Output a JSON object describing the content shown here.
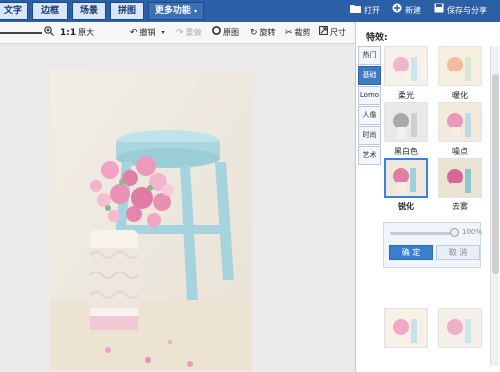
{
  "topbar": {
    "tabs": [
      "文字",
      "边框",
      "场景",
      "拼图"
    ],
    "more_label": "更多功能",
    "open_label": "打开",
    "new_label": "新建",
    "save_label": "保存与分享"
  },
  "toolbar": {
    "original_size": "原大",
    "undo": "撤销",
    "redo": "重做",
    "original_image": "原图",
    "rotate": "旋转",
    "crop": "裁剪",
    "resize": "尺寸"
  },
  "panel": {
    "title": "特效:",
    "categories": [
      "热门",
      "基础",
      "Lomo",
      "人像",
      "时尚",
      "艺术"
    ],
    "active_category": "基础",
    "filters": [
      "柔光",
      "暖化",
      "黑白色",
      "噪点",
      "锐化",
      "去雾"
    ],
    "selected_filter": "锐化",
    "slider_value": "100%",
    "confirm_label": "确 定",
    "cancel_label": "取 消"
  },
  "colors": {
    "accent": "#2b5fa6",
    "button": "#3a7fcf",
    "canvas_bg": "#eaeaea"
  }
}
